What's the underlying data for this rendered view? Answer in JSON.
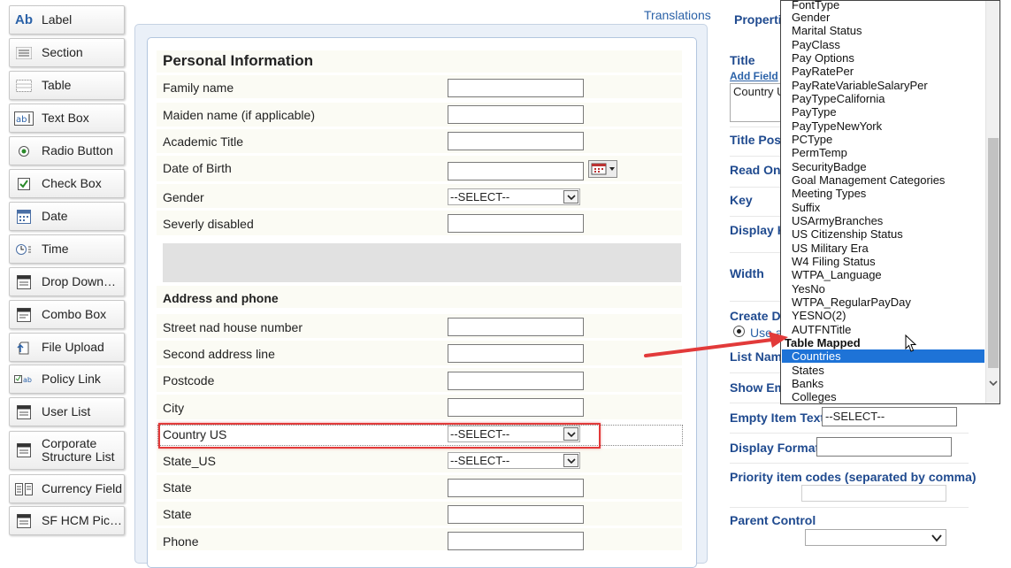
{
  "toolbox": {
    "items": [
      {
        "label": "Label",
        "icon": "label-ab-icon"
      },
      {
        "label": "Section",
        "icon": "section-lines-icon"
      },
      {
        "label": "Table",
        "icon": "table-grid-icon"
      },
      {
        "label": "Text Box",
        "icon": "textbox-icon"
      },
      {
        "label": "Radio Button",
        "icon": "radio-icon"
      },
      {
        "label": "Check Box",
        "icon": "checkbox-icon"
      },
      {
        "label": "Date",
        "icon": "calendar-icon"
      },
      {
        "label": "Time",
        "icon": "clock-icon"
      },
      {
        "label": "Drop Down…",
        "icon": "dropdown-list-icon"
      },
      {
        "label": "Combo Box",
        "icon": "combobox-icon"
      },
      {
        "label": "File Upload",
        "icon": "file-upload-icon"
      },
      {
        "label": "Policy Link",
        "icon": "policy-link-icon"
      },
      {
        "label": "User List",
        "icon": "user-list-icon"
      },
      {
        "label": "Corporate Structure List",
        "icon": "structure-list-icon"
      },
      {
        "label": "Currency Field",
        "icon": "currency-icon"
      },
      {
        "label": "SF HCM Pic…",
        "icon": "sf-hcm-icon"
      }
    ]
  },
  "form": {
    "translations_link": "Translations",
    "section1_title": "Personal Information",
    "fields1": [
      {
        "label": "Family name"
      },
      {
        "label": "Maiden name (if applicable)"
      },
      {
        "label": "Academic Title"
      },
      {
        "label": "Date of Birth"
      },
      {
        "label": "Gender",
        "value": "--SELECT--"
      },
      {
        "label": "Severly disabled"
      }
    ],
    "section2_title": "Address and phone",
    "fields2": [
      {
        "label": "Street nad house number"
      },
      {
        "label": "Second address line"
      },
      {
        "label": "Postcode"
      },
      {
        "label": "City"
      },
      {
        "label": "Country US",
        "value": "--SELECT--"
      },
      {
        "label": "State_US",
        "value": "--SELECT--"
      },
      {
        "label": "State"
      },
      {
        "label": "State"
      },
      {
        "label": "Phone"
      }
    ]
  },
  "properties": {
    "header": "Properties",
    "title_label": "Title",
    "add_field": "Add Field",
    "title_value": "Country US",
    "title_position": "Title Posi",
    "read_only": "Read Onl",
    "key": "Key",
    "display_key": "Display K",
    "width": "Width",
    "create_dropdown": "Create Dr",
    "use_option": "Use a",
    "list_name": "List Nam",
    "show_empty": "Show Em",
    "empty_item_text_label": "Empty Item Text",
    "empty_item_text_value": "--SELECT--",
    "display_format_label": "Display Format",
    "display_format_value": "",
    "priority_codes_label": "Priority item codes (separated by comma)",
    "priority_codes_value": "",
    "parent_control_label": "Parent Control",
    "parent_control_value": ""
  },
  "dropdown": {
    "options": [
      "FontType",
      "Gender",
      "Marital Status",
      "PayClass",
      "Pay Options",
      "PayRatePer",
      "PayRateVariableSalaryPer",
      "PayTypeCalifornia",
      "PayType",
      "PayTypeNewYork",
      "PCType",
      "PermTemp",
      "SecurityBadge",
      "Goal Management Categories",
      "Meeting Types",
      "Suffix",
      "USArmyBranches",
      "US Citizenship Status",
      "US Military Era",
      "W4 Filing Status",
      "WTPA_Language",
      "YesNo",
      "WTPA_RegularPayDay",
      "YESNO(2)",
      "AUTFNTitle"
    ],
    "group_label": "Table Mapped",
    "table_options": [
      "Countries",
      "States",
      "Banks",
      "Colleges"
    ],
    "selected": "Countries"
  },
  "colors": {
    "highlight": "#1e73d7",
    "annotation": "#e23a3a",
    "label_blue": "#1f4a8f"
  }
}
